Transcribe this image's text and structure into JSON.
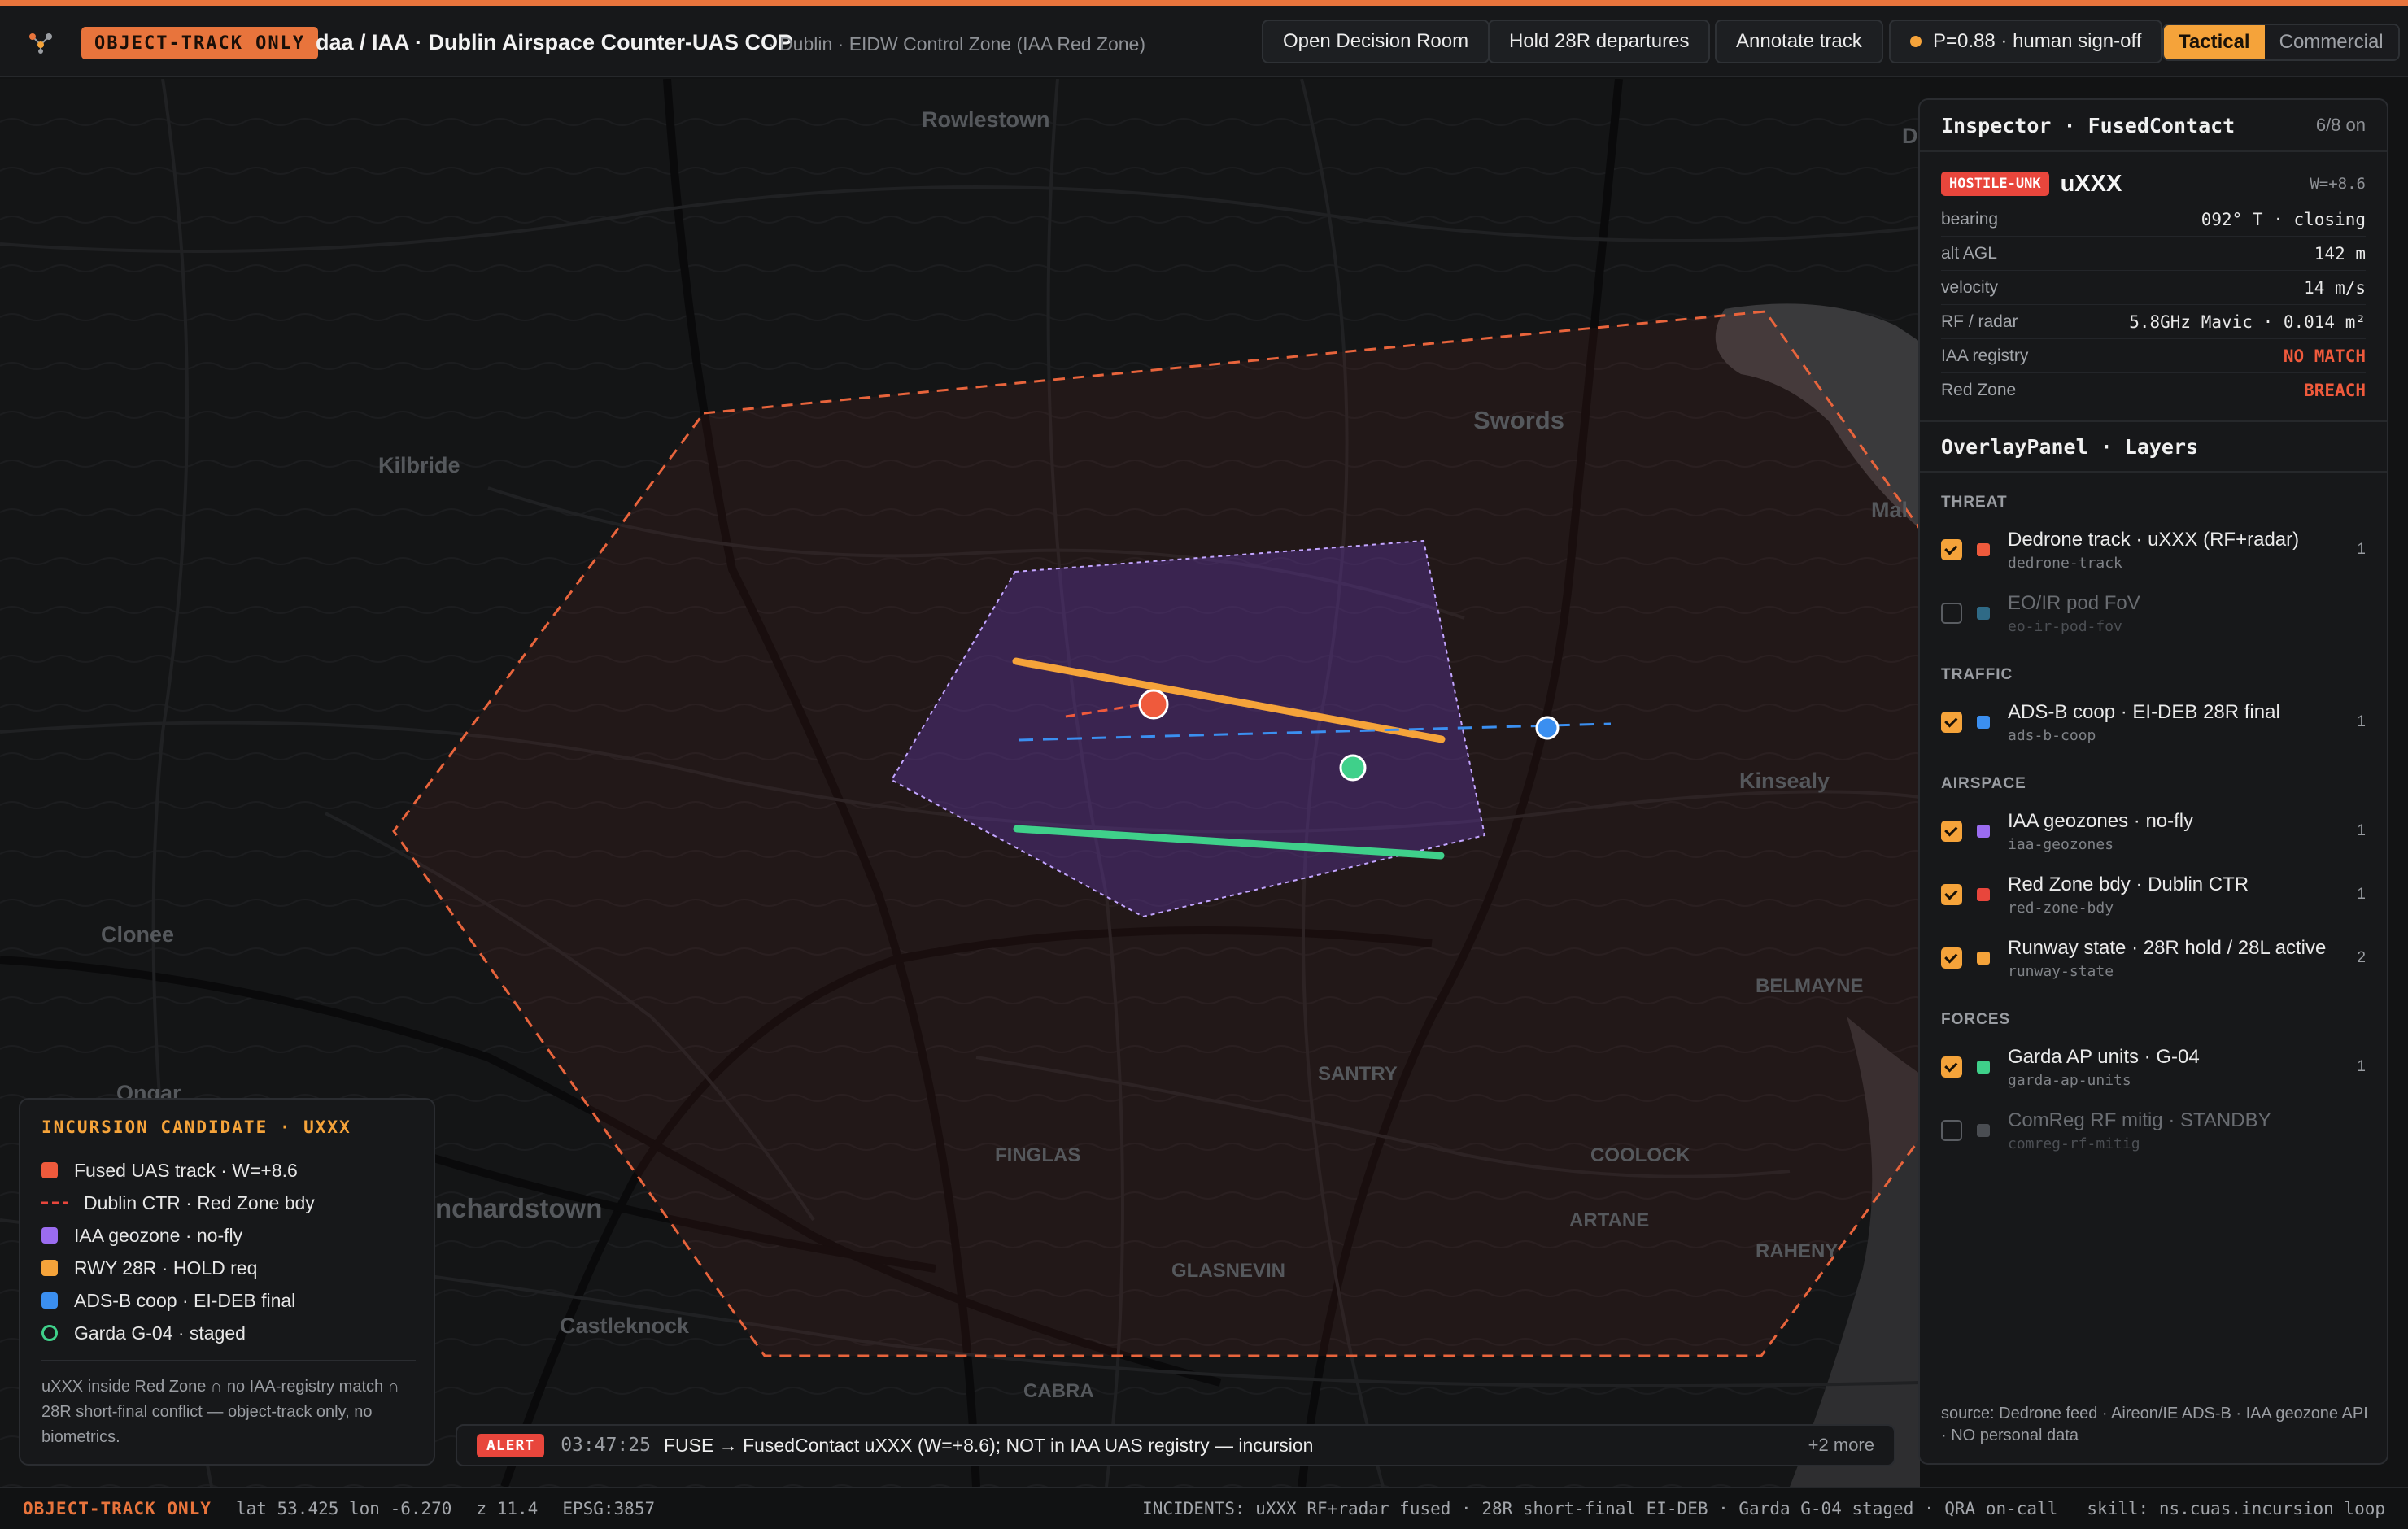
{
  "header": {
    "badge": "OBJECT-TRACK ONLY",
    "title": "daa / IAA · Dublin Airspace Counter-UAS COP",
    "subtitle": "· Dublin · EIDW Control Zone (IAA Red Zone)",
    "buttons": {
      "decision_room": "Open Decision Room",
      "hold": "Hold 28R departures",
      "annotate": "Annotate track"
    },
    "probability": "P=0.88 · human sign-off",
    "mode_toggle": {
      "active": "Tactical",
      "inactive": "Commercial"
    }
  },
  "map": {
    "places": {
      "rowlestown": "Rowlestown",
      "swords": "Swords",
      "kilbride": "Kilbride",
      "kinsealy": "Kinsealy",
      "clonee": "Clonee",
      "belmayne": "BELMAYNE",
      "santry": "SANTRY",
      "finglas": "FINGLAS",
      "coolock": "COOLOCK",
      "artane": "ARTANE",
      "glasnevin": "GLASNEVIN",
      "blanchardstown": "nchardstown",
      "castleknock": "Castleknock",
      "raheny": "RAHENY",
      "cabra": "CABRA",
      "ongar": "Ongar",
      "edge_d": "D",
      "edge_mal": "Mal"
    }
  },
  "legend": {
    "title": "INCURSION CANDIDATE · UXXX",
    "items": [
      {
        "label": "Fused UAS track · W=+8.6",
        "color": "#ef5a3c"
      },
      {
        "label": "Dublin CTR · Red Zone bdy",
        "color": "#e8463c"
      },
      {
        "label": "IAA geozone · no-fly",
        "color": "#9b6cf0"
      },
      {
        "label": "RWY 28R · HOLD req",
        "color": "#f5a33a"
      },
      {
        "label": "ADS-B coop · EI-DEB final",
        "color": "#3b8ff0"
      },
      {
        "label": "Garda G-04 · staged",
        "color": "#3fd08a"
      }
    ],
    "note": "uXXX inside Red Zone ∩ no IAA-registry match ∩ 28R short-final conflict — object-track only, no biometrics."
  },
  "inspector": {
    "title": "Inspector · FusedContact",
    "count": "6/8 on",
    "badge": "HOSTILE-UNK",
    "track_id": "uXXX",
    "weight": "W=+8.6",
    "rows": [
      {
        "k": "bearing",
        "v": "092° T · closing"
      },
      {
        "k": "alt AGL",
        "v": "142 m"
      },
      {
        "k": "velocity",
        "v": "14 m/s"
      },
      {
        "k": "RF / radar",
        "v": "5.8GHz Mavic · 0.014 m²"
      },
      {
        "k": "IAA registry",
        "v": "NO MATCH"
      },
      {
        "k": "Red Zone",
        "v": "BREACH"
      }
    ]
  },
  "overlay": {
    "title": "OverlayPanel · Layers",
    "groups": {
      "threat": "THREAT",
      "traffic": "TRAFFIC",
      "airspace": "AIRSPACE",
      "forces": "FORCES"
    },
    "layers": [
      {
        "name": "Dedrone track · uXXX (RF+radar)",
        "key": "dedrone-track",
        "count": "1",
        "color": "#ef5a3c",
        "on": true
      },
      {
        "name": "EO/IR pod FoV",
        "key": "eo-ir-pod-fov",
        "count": "",
        "color": "#2f6a86",
        "on": false
      },
      {
        "name": "ADS-B coop · EI-DEB 28R final",
        "key": "ads-b-coop",
        "count": "1",
        "color": "#3b8ff0",
        "on": true
      },
      {
        "name": "IAA geozones · no-fly",
        "key": "iaa-geozones",
        "count": "1",
        "color": "#9b6cf0",
        "on": true
      },
      {
        "name": "Red Zone bdy · Dublin CTR",
        "key": "red-zone-bdy",
        "count": "1",
        "color": "#e8463c",
        "on": true
      },
      {
        "name": "Runway state · 28R hold / 28L active",
        "key": "runway-state",
        "count": "2",
        "color": "#f5a33a",
        "on": true
      },
      {
        "name": "Garda AP units · G-04",
        "key": "garda-ap-units",
        "count": "1",
        "color": "#3fd08a",
        "on": true
      },
      {
        "name": "ComReg RF mitig · STANDBY",
        "key": "comreg-rf-mitig",
        "count": "",
        "color": "#4a4d52",
        "on": false
      }
    ],
    "source": "source: Dedrone feed · Aireon/IE ADS-B · IAA geozone API · NO personal data"
  },
  "alert": {
    "badge": "ALERT",
    "time": "03:47:25",
    "message": "FUSE → FusedContact uXXX (W=+8.6); NOT in IAA UAS registry — incursion",
    "more": "+2 more"
  },
  "status": {
    "badge": "OBJECT-TRACK ONLY",
    "coords": "lat 53.425 lon -6.270",
    "zoom": "z 11.4",
    "epsg": "EPSG:3857",
    "incidents": "INCIDENTS: uXXX RF+radar fused · 28R short-final EI-DEB · Garda G-04 staged · QRA on-call",
    "skill": "skill: ns.cuas.incursion_loop"
  }
}
